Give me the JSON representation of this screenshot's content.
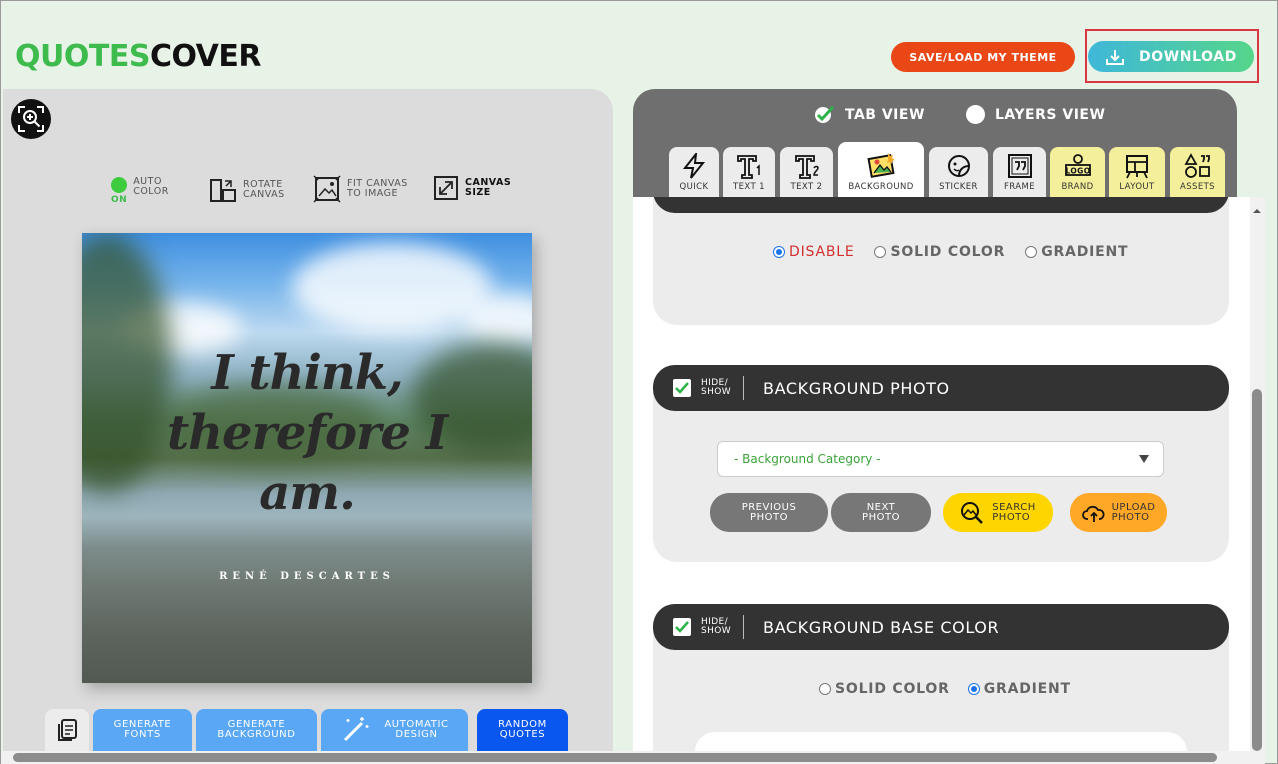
{
  "logo": {
    "part1": "QUOTES",
    "part2": "COVER"
  },
  "header": {
    "save_load": "SAVE/LOAD MY THEME",
    "download": "DOWNLOAD"
  },
  "left_tools": {
    "auto_color": {
      "line1": "AUTO",
      "line2": "COLOR",
      "state": "ON"
    },
    "rotate": {
      "line1": "ROTATE",
      "line2": "CANVAS"
    },
    "fit": {
      "line1": "FIT CANVAS",
      "line2": "TO IMAGE"
    },
    "size": {
      "line1": "CANVAS",
      "line2": "SIZE"
    }
  },
  "canvas": {
    "quote_lines": [
      "I think,",
      "therefore I",
      "am."
    ],
    "author": "RENÉ DESCARTES"
  },
  "bottom_buttons": {
    "gen_fonts": {
      "line1": "GENERATE",
      "line2": "FONTS"
    },
    "gen_bg": {
      "line1": "GENERATE",
      "line2": "BACKGROUND"
    },
    "auto_design": {
      "line1": "AUTOMATIC",
      "line2": "DESIGN"
    },
    "random": {
      "line1": "RANDOM",
      "line2": "QUOTES"
    }
  },
  "views": {
    "tab_view": "TAB VIEW",
    "layers_view": "LAYERS VIEW"
  },
  "tabs": [
    {
      "label": "QUICK"
    },
    {
      "label": "TEXT 1"
    },
    {
      "label": "TEXT 2"
    },
    {
      "label": "BACKGROUND"
    },
    {
      "label": "STICKER"
    },
    {
      "label": "FRAME"
    },
    {
      "label": "BRAND"
    },
    {
      "label": "LAYOUT"
    },
    {
      "label": "ASSETS"
    }
  ],
  "fill_section": {
    "disable": "DISABLE",
    "solid": "SOLID COLOR",
    "gradient": "GRADIENT",
    "selected": "disable"
  },
  "bg_photo": {
    "hide_show": [
      "HIDE/",
      "SHOW"
    ],
    "title": "BACKGROUND PHOTO",
    "category_placeholder": "- Background Category -",
    "prev": [
      "PREVIOUS",
      "PHOTO"
    ],
    "next": [
      "NEXT",
      "PHOTO"
    ],
    "search": [
      "SEARCH",
      "PHOTO"
    ],
    "upload": [
      "UPLOAD",
      "PHOTO"
    ]
  },
  "bg_base": {
    "hide_show": [
      "HIDE/",
      "SHOW"
    ],
    "title": "BACKGROUND BASE COLOR",
    "solid": "SOLID COLOR",
    "gradient": "GRADIENT",
    "selected": "gradient"
  },
  "colors": {
    "brand_green": "#3dbb4c",
    "save_orange": "#e94716",
    "accent_blue": "#1a73e8",
    "disable_red": "#d32f2f"
  }
}
